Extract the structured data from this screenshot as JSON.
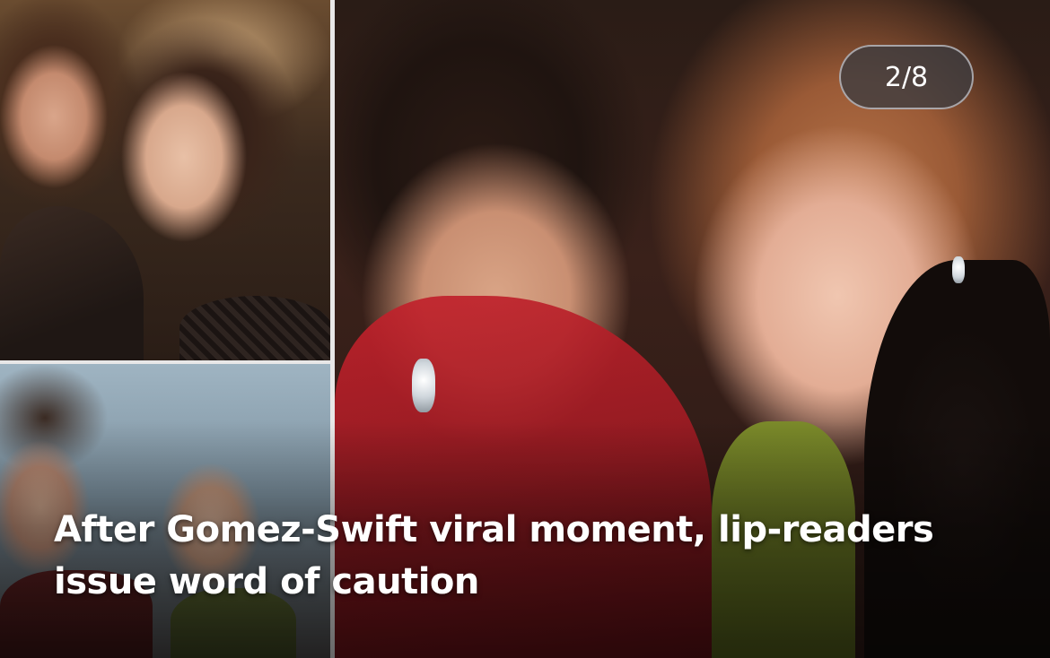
{
  "slideshow": {
    "counter": "2/8",
    "headline": "After Gomez-Swift viral moment, lip-readers issue word of caution"
  }
}
